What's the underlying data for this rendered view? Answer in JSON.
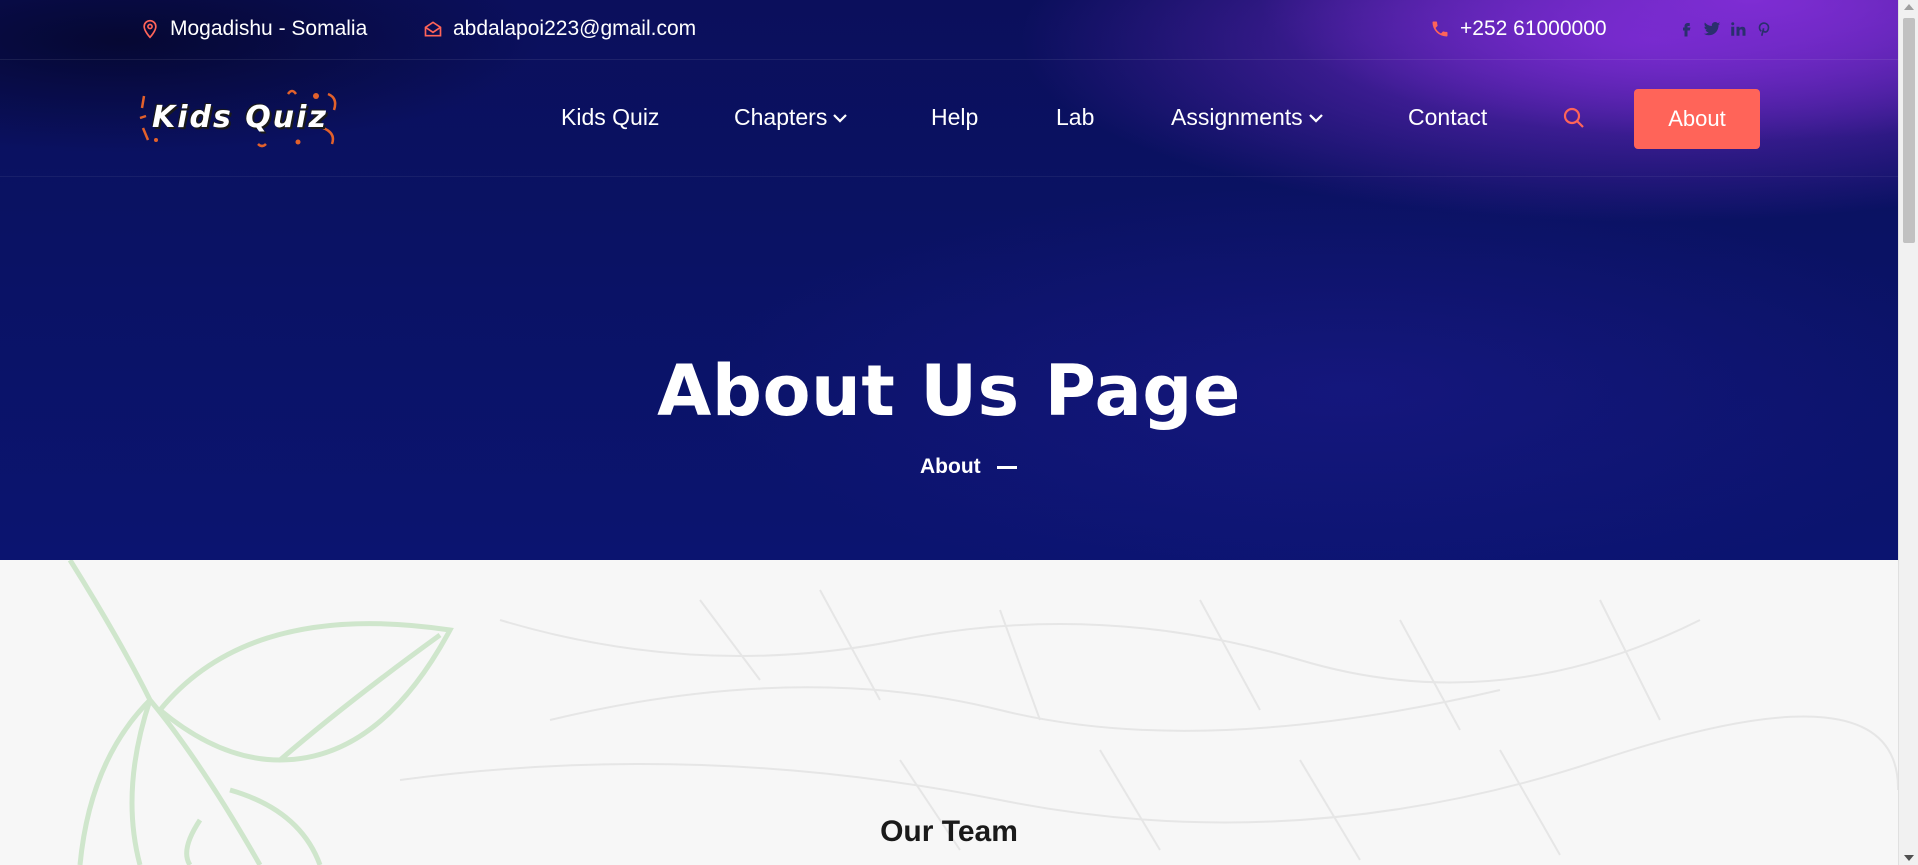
{
  "topbar": {
    "location": "Mogadishu - Somalia",
    "email": "abdalapoi223@gmail.com",
    "phone": "+252 61000000",
    "socials": [
      "facebook-icon",
      "twitter-icon",
      "linkedin-icon",
      "pinterest-icon"
    ]
  },
  "logo": {
    "text": "Kids Quiz"
  },
  "nav": {
    "kids_quiz": "Kids Quiz",
    "chapters": "Chapters",
    "help": "Help",
    "lab": "Lab",
    "assignments": "Assignments",
    "contact": "Contact",
    "about_button": "About"
  },
  "hero": {
    "title": "About Us Page",
    "breadcrumb": "About"
  },
  "section": {
    "title": "Our Team"
  },
  "colors": {
    "accent": "#ff6459",
    "hero_dark": "#0b1470",
    "hero_purple": "#7e2cd6"
  }
}
